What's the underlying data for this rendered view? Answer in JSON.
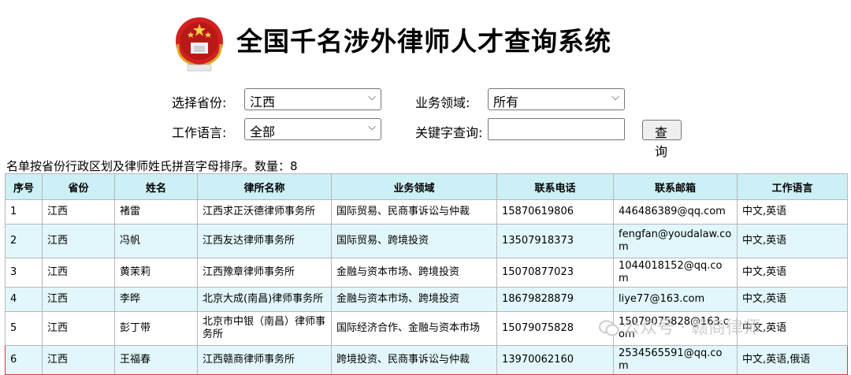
{
  "header": {
    "title": "全国千名涉外律师人才查询系统"
  },
  "filters": {
    "province_label": "选择省份:",
    "province_value": "江西",
    "domain_label": "业务领域:",
    "domain_value": "所有",
    "language_label": "工作语言:",
    "language_value": "全部",
    "keyword_label": "关键字查询:",
    "keyword_value": "",
    "search_button": "查 询"
  },
  "summary": "名单按省份行政区划及律师姓氏拼音字母排序。数量：8",
  "table": {
    "columns": [
      "序号",
      "省份",
      "姓名",
      "律所名称",
      "业务领域",
      "联系电话",
      "联系邮箱",
      "工作语言"
    ],
    "rows": [
      [
        "1",
        "江西",
        "褚雷",
        "江西求正沃德律师事务所",
        "国际贸易、民商事诉讼与仲裁",
        "15870619806",
        "446486389@qq.com",
        "中文,英语"
      ],
      [
        "2",
        "江西",
        "冯帆",
        "江西友达律师事务所",
        "国际贸易、跨境投资",
        "13507918373",
        "fengfan@youdalaw.com",
        "中文,英语"
      ],
      [
        "3",
        "江西",
        "黄茉莉",
        "江西豫章律师事务所",
        "金融与资本市场、跨境投资",
        "15070877023",
        "1044018152@qq.com",
        "中文,英语"
      ],
      [
        "4",
        "江西",
        "李晔",
        "北京大成(南昌)律师事务所",
        "金融与资本市场、跨境投资",
        "18679828879",
        "liye77@163.com",
        "中文,英语"
      ],
      [
        "5",
        "江西",
        "彭丁带",
        "北京市中银（南昌）律师事务所",
        "国际经济合作、金融与资本市场",
        "15079075828",
        "15079075828@163.com",
        "中文,英语"
      ],
      [
        "6",
        "江西",
        "王福春",
        "江西赣商律师事务所",
        "跨境投资、民商事诉讼与仲裁",
        "13970062160",
        "2534565591@qq.com",
        "中文,英语,俄语"
      ]
    ]
  },
  "watermark": "公众号 · 赣商律师",
  "icons": {
    "emblem": "national-emblem-icon",
    "chevron": "chevron-down-icon",
    "wechat": "wechat-icon"
  },
  "colors": {
    "header_bg": "#cdeff6",
    "row_alt": "#e2f7fb",
    "highlight": "#d93a3a"
  }
}
